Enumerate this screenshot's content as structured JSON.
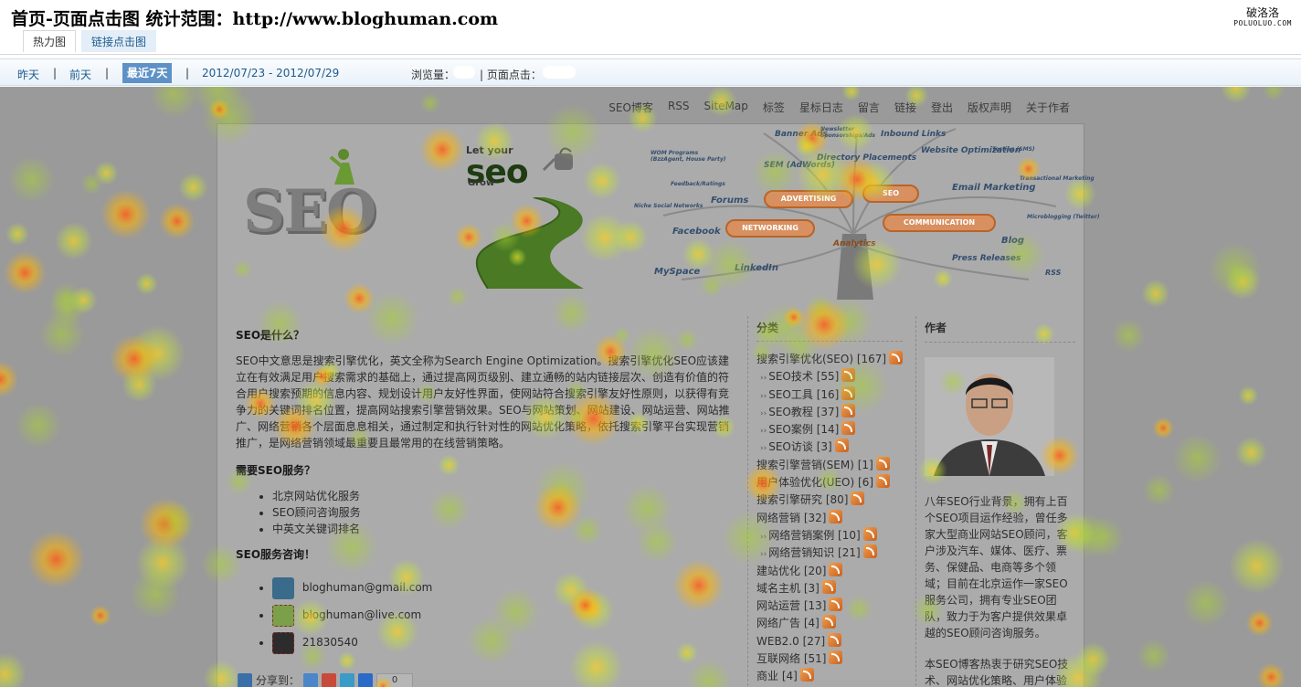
{
  "header": {
    "title": "首页-页面点击图 统计范围：http://www.bloghuman.com",
    "tabs": [
      {
        "label": "热力图"
      },
      {
        "label": "链接点击图"
      }
    ],
    "brand_cn": "破洛洛",
    "brand_en": "POLUOLUO.COM"
  },
  "filters": {
    "yesterday": "昨天",
    "day_before": "前天",
    "last7": "最近7天",
    "sep": "|",
    "range": "2012/07/23 - 2012/07/29",
    "pageviews_label": "浏览量：",
    "clicks_label": "| 页面点击："
  },
  "site": {
    "nav": [
      "SEO博客",
      "RSS",
      "SiteMap",
      "标签",
      "星标日志",
      "留言",
      "链接",
      "登出",
      "版权声明",
      "关于作者"
    ],
    "banner": {
      "seo_big": "SEO",
      "let_your": "Let your",
      "seo_small": "seo",
      "grow": "Grow",
      "tree_labels": [
        "Banner Ads",
        "Newsletter Sponsorships/Ads",
        "Inbound Links",
        "WOM Programs (BzzAgent, House Party)",
        "Directory Placements",
        "Website Optimization",
        "Testing (SMS)",
        "SEM (AdWords)",
        "Feedback/Ratings",
        "Forums",
        "Email Marketing",
        "Transactional Marketing",
        "Niche Social Networks",
        "Facebook",
        "Microblogging (Twitter)",
        "Analytics",
        "Blog",
        "MySpace",
        "LinkedIn",
        "Press Releases",
        "RSS"
      ],
      "pills": [
        "ADVERTISING",
        "SEO",
        "NETWORKING",
        "COMMUNICATION"
      ]
    },
    "main": {
      "h1": "SEO是什么？",
      "p1": "SEO中文意思是搜索引擎优化，英文全称为Search Engine Optimization。搜索引擎优化SEO应该建立在有效满足用户搜索需求的基础上，通过提高网页级别、建立通畅的站内链接层次、创造有价值的符合用户搜索预期的信息内容、规划设计用户友好性界面，使网站符合搜索引擎友好性原则，以获得有竞争力的关键词排名位置，提高网站搜索引擎营销效果。SEO与网站策划、网站建设、网站运营、网站推广、网络营销各个层面息息相关，通过制定和执行针对性的网站优化策略，依托搜索引擎平台实现营销推广，是网络营销领域最重要且最常用的在线营销策略。",
      "h2": "需要SEO服务？",
      "services": [
        "北京网站优化服务",
        "SEO顾问咨询服务",
        "中英文关键词排名"
      ],
      "h3": "SEO服务咨询！",
      "contacts": [
        "bloghuman@gmail.com",
        "bloghuman@live.com",
        "21830540"
      ],
      "share_label": "分享到：",
      "share_count": "0"
    },
    "categories": {
      "title": "分类",
      "items": [
        {
          "label": "搜索引擎优化(SEO)",
          "count": "[167]",
          "sub": false
        },
        {
          "label": "SEO技术",
          "count": "[55]",
          "sub": true
        },
        {
          "label": "SEO工具",
          "count": "[16]",
          "sub": true
        },
        {
          "label": "SEO教程",
          "count": "[37]",
          "sub": true
        },
        {
          "label": "SEO案例",
          "count": "[14]",
          "sub": true
        },
        {
          "label": "SEO访谈",
          "count": "[3]",
          "sub": true
        },
        {
          "label": "搜索引擎营销(SEM)",
          "count": "[1]",
          "sub": false
        },
        {
          "label": "用户体验优化(UEO)",
          "count": "[6]",
          "sub": false
        },
        {
          "label": "搜索引擎研究",
          "count": "[80]",
          "sub": false
        },
        {
          "label": "网络营销",
          "count": "[32]",
          "sub": false
        },
        {
          "label": "网络营销案例",
          "count": "[10]",
          "sub": true
        },
        {
          "label": "网络营销知识",
          "count": "[21]",
          "sub": true
        },
        {
          "label": "建站优化",
          "count": "[20]",
          "sub": false
        },
        {
          "label": "域名主机",
          "count": "[3]",
          "sub": false
        },
        {
          "label": "网站运营",
          "count": "[13]",
          "sub": false
        },
        {
          "label": "网络广告",
          "count": "[4]",
          "sub": false
        },
        {
          "label": "WEB2.0",
          "count": "[27]",
          "sub": false
        },
        {
          "label": "互联网络",
          "count": "[51]",
          "sub": false
        },
        {
          "label": "商业",
          "count": "[4]",
          "sub": false
        }
      ]
    },
    "author": {
      "title": "作者",
      "p1": "八年SEO行业背景，拥有上百个SEO项目运作经验，曾任多家大型商业网站SEO顾问，客户涉及汽车、媒体、医疗、票务、保健品、电商等多个领域；目前在北京运作一家SEO服务公司，拥有专业SEO团队，致力于为客户提供效果卓越的SEO顾问咨询服务。",
      "p2": "本SEO博客热衷于研究SEO技术、网站优化策略、用户体验优化、关键词营销数据挖掘、"
    }
  },
  "colors": {
    "accent": "#5e92c6",
    "link": "#1d5a8c",
    "overlay": "#9a9a9a"
  }
}
